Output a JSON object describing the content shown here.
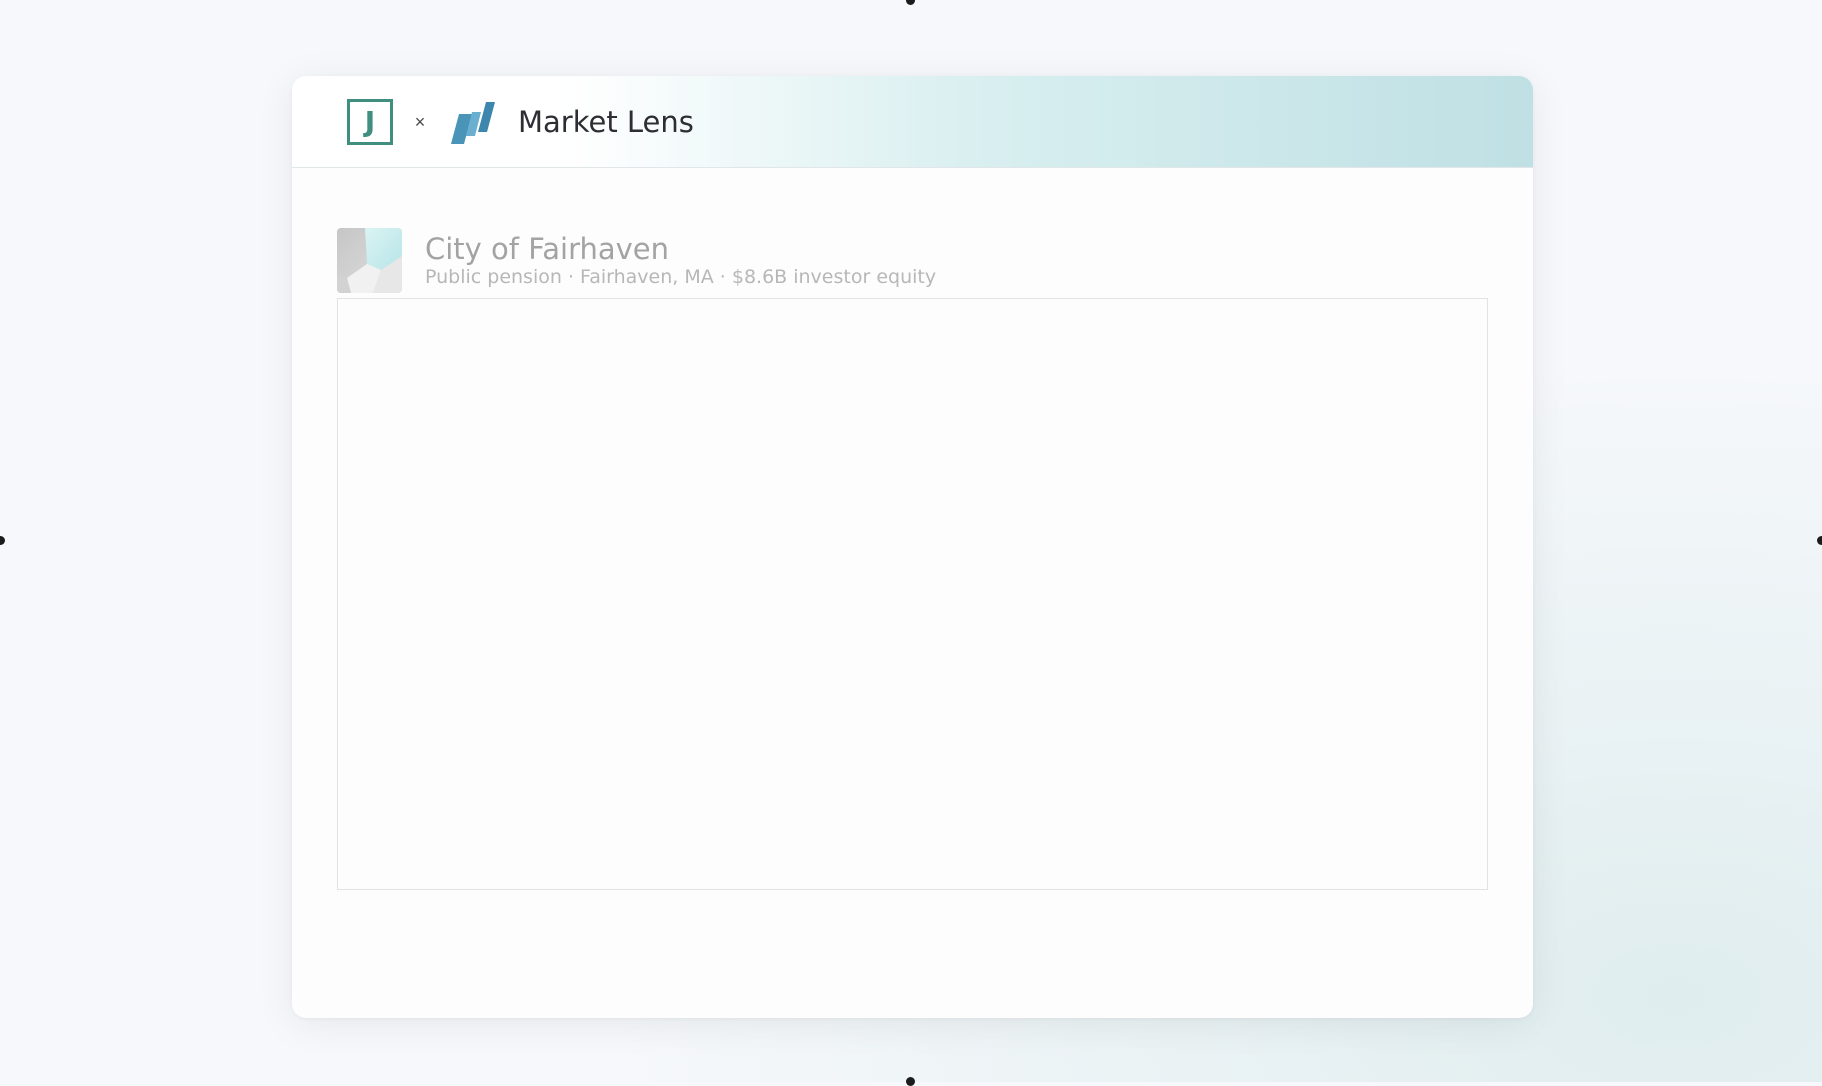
{
  "window": {
    "background_color": "#f6f8fb"
  },
  "header": {
    "logo_left": {
      "icon": "j-logo-icon",
      "text": "J",
      "color": "#3f8e7f"
    },
    "separator": "×",
    "logo_right": {
      "icon": "market-lens-logo-icon",
      "color": "#4a94b8"
    },
    "title": "Market Lens",
    "gradient_colors": [
      "#ffffff",
      "#d9eff0",
      "#bfe0e4"
    ]
  },
  "entity": {
    "thumbnail_icon": "building-photo-icon",
    "name": "City of Fairhaven",
    "subtitle": "Public pension · Fairhaven, MA · $8.6B investor equity"
  },
  "content": {
    "state": "empty",
    "border_color": "#e3e3e3"
  }
}
